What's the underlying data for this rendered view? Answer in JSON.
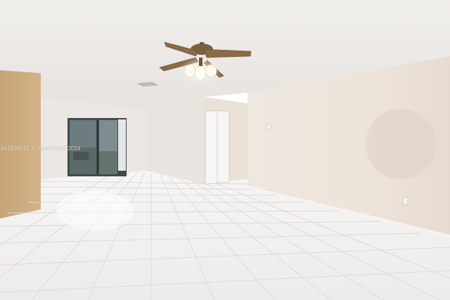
{
  "photo": {
    "watermark": "A11838212 © Miami MLS 2024"
  },
  "colors": {
    "ceiling": "#eeece8",
    "wall_right": "#ece4db",
    "wall_back": "#ebe6e2",
    "accent_wall": "#c9a87a",
    "floor_tile": "#f2f0ef",
    "grout": "#dddad8",
    "fan_blade": "#8b6a47",
    "fan_body": "#6e563e",
    "door": "#f5f4f2",
    "sliding_glass": "#5a6a6f"
  }
}
